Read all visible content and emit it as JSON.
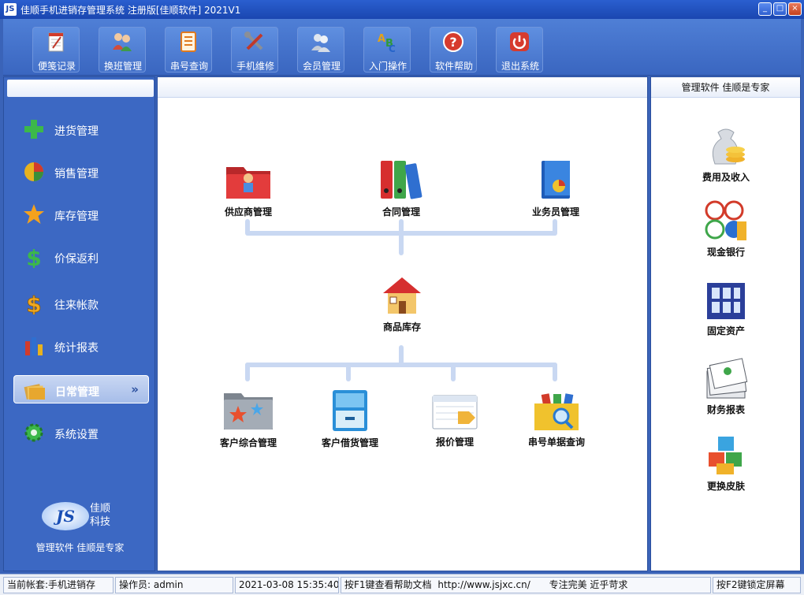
{
  "window": {
    "title": "佳顺手机进销存管理系统 注册版[佳顺软件] 2021V1",
    "buttons": {
      "minimize": "_",
      "maximize": "□",
      "close": "×"
    }
  },
  "toolbar": {
    "items": [
      {
        "label": "便笺记录",
        "icon": "notepad-icon"
      },
      {
        "label": "换班管理",
        "icon": "users-shift-icon"
      },
      {
        "label": "串号查询",
        "icon": "document-list-icon"
      },
      {
        "label": "手机维修",
        "icon": "tools-icon"
      },
      {
        "label": "会员管理",
        "icon": "members-icon"
      },
      {
        "label": "入门操作",
        "icon": "abc-icon"
      },
      {
        "label": "软件帮助",
        "icon": "help-icon"
      },
      {
        "label": "退出系统",
        "icon": "power-icon"
      }
    ]
  },
  "sidebar": {
    "items": [
      {
        "label": "进货管理",
        "icon": "plus-icon"
      },
      {
        "label": "销售管理",
        "icon": "pie-chart-icon"
      },
      {
        "label": "库存管理",
        "icon": "star-icon"
      },
      {
        "label": "价保返利",
        "icon": "dollar-icon"
      },
      {
        "label": "往来帐款",
        "icon": "dollar-gold-icon"
      },
      {
        "label": "统计报表",
        "icon": "bar-chart-icon"
      },
      {
        "label": "日常管理",
        "icon": "folders-icon",
        "active": true,
        "chevron": "»"
      },
      {
        "label": "系统设置",
        "icon": "gear-icon"
      }
    ],
    "brand": {
      "logo": "JS",
      "name_line1": "佳顺",
      "name_line2": "科技",
      "slogan": "管理软件 佳顺是专家"
    }
  },
  "main": {
    "top_items": [
      {
        "label": "供应商管理",
        "icon": "red-folder-icon"
      },
      {
        "label": "合同管理",
        "icon": "binders-icon"
      },
      {
        "label": "业务员管理",
        "icon": "blue-book-icon"
      }
    ],
    "center_item": {
      "label": "商品库存",
      "icon": "house-icon"
    },
    "bottom_items": [
      {
        "label": "客户综合管理",
        "icon": "star-folder-icon"
      },
      {
        "label": "客户借货管理",
        "icon": "cabinet-icon"
      },
      {
        "label": "报价管理",
        "icon": "price-tag-icon"
      },
      {
        "label": "串号单据查询",
        "icon": "search-folder-icon"
      }
    ]
  },
  "rightpanel": {
    "header": "管理软件  佳顺是专家",
    "items": [
      {
        "label": "费用及收入",
        "icon": "money-bag-icon"
      },
      {
        "label": "现金银行",
        "icon": "bank-icon"
      },
      {
        "label": "固定资产",
        "icon": "building-icon"
      },
      {
        "label": "财务报表",
        "icon": "report-stack-icon"
      },
      {
        "label": "更换皮肤",
        "icon": "cubes-icon"
      }
    ]
  },
  "status": {
    "account": "当前帐套:手机进销存",
    "operator": "操作员: admin",
    "datetime": "2021-03-08 15:35:40",
    "help": "按F1键查看帮助文档",
    "url": "http://www.jsjxc.cn/",
    "motto": "专注完美 近乎苛求",
    "lock": "按F2键锁定屏幕"
  },
  "colors": {
    "accent": "#3a63b8",
    "titlebar": "#1a46b0",
    "connector": "#c9d8f2"
  }
}
